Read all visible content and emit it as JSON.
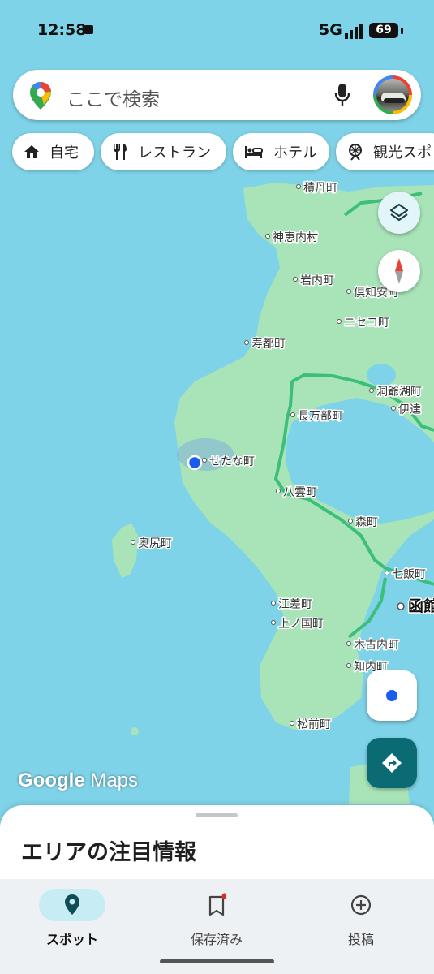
{
  "status_bar": {
    "time": "12:58",
    "network": "5G",
    "battery": "69"
  },
  "search": {
    "placeholder": "ここで検索"
  },
  "chips": [
    {
      "label": "自宅",
      "icon": "home-icon"
    },
    {
      "label": "レストラン",
      "icon": "restaurant-icon"
    },
    {
      "label": "ホテル",
      "icon": "hotel-icon"
    },
    {
      "label": "観光スポ",
      "icon": "attraction-icon"
    }
  ],
  "map": {
    "places": [
      "積丹町",
      "神恵内村",
      "岩内町",
      "倶知安町",
      "ニセコ町",
      "寿都町",
      "洞爺湖町",
      "伊達",
      "長万部町",
      "せたな町",
      "八雲町",
      "森町",
      "奥尻町",
      "七飯町",
      "函館",
      "江差町",
      "上ノ国町",
      "木古内町",
      "知内町",
      "松前町"
    ],
    "current_location": "せたな町",
    "colors": {
      "water": "#7fd3e8",
      "land": "#a8e4b8",
      "route": "#3cbf7a",
      "accent": "#0b6b74",
      "location": "#1a5cf0"
    }
  },
  "watermark": {
    "part1": "Google",
    "part2": " Maps"
  },
  "sheet": {
    "title": "エリアの注目情報"
  },
  "nav": [
    {
      "label": "スポット",
      "icon": "place-pin-icon",
      "active": true
    },
    {
      "label": "保存済み",
      "icon": "bookmark-icon",
      "active": false
    },
    {
      "label": "投稿",
      "icon": "add-circle-icon",
      "active": false
    }
  ]
}
